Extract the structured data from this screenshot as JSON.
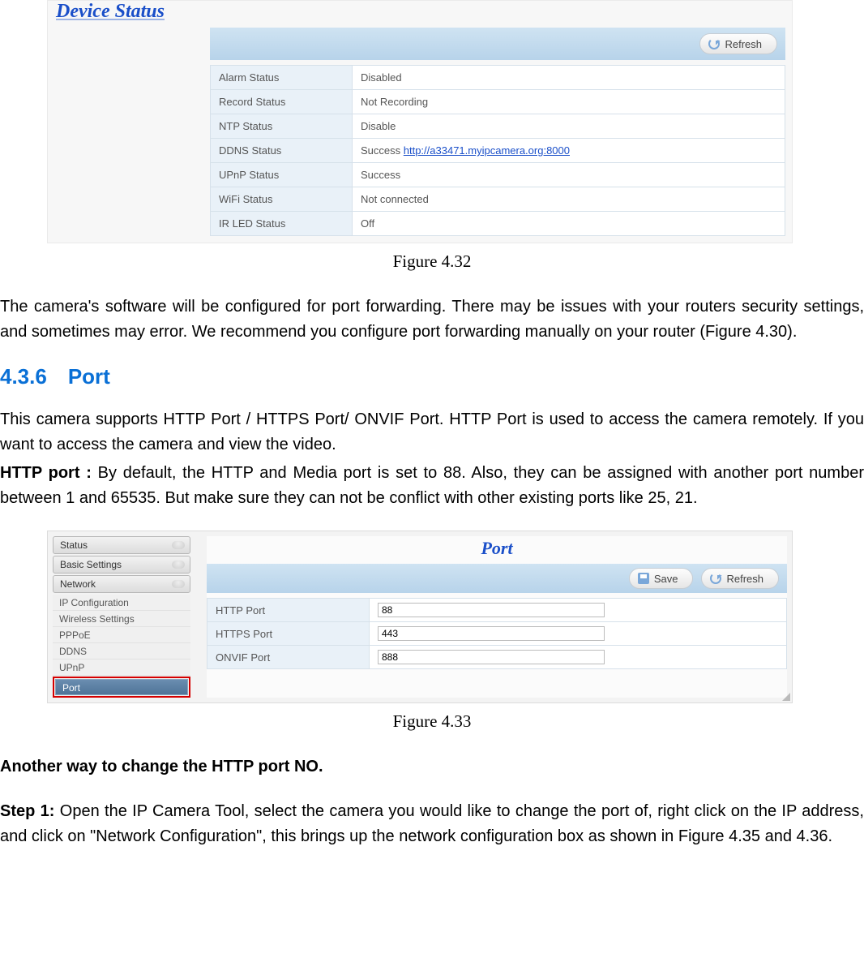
{
  "fig432": {
    "title": "Device Status",
    "refresh": "Refresh",
    "rows": [
      {
        "label": "Alarm Status",
        "value": "Disabled"
      },
      {
        "label": "Record Status",
        "value": "Not Recording"
      },
      {
        "label": "NTP Status",
        "value": "Disable"
      },
      {
        "label": "DDNS Status",
        "value_prefix": "Success ",
        "link": "http://a33471.myipcamera.org:8000"
      },
      {
        "label": "UPnP Status",
        "value": "Success"
      },
      {
        "label": "WiFi Status",
        "value": "Not connected"
      },
      {
        "label": "IR LED Status",
        "value": "Off"
      }
    ],
    "caption": "Figure 4.32"
  },
  "para1": "The camera's software will be configured for port forwarding. There may be issues with your routers security settings, and sometimes may error. We recommend you configure port forwarding manually on your router (Figure 4.30).",
  "section_heading": "4.3.6 Port",
  "para2": "This camera supports HTTP Port / HTTPS Port/ ONVIF Port. HTTP Port is used to access the camera remotely. If you want to access the camera and view the video.",
  "para3_bold": "HTTP port : ",
  "para3_rest": "By default, the HTTP and Media port is set to 88. Also, they can be assigned with another port number between 1 and 65535. But make sure they can not be conflict with other existing ports like 25, 21.",
  "fig433": {
    "sidebar_groups": [
      "Status",
      "Basic Settings",
      "Network"
    ],
    "sidebar_items": [
      "IP Configuration",
      "Wireless Settings",
      "PPPoE",
      "DDNS",
      "UPnP"
    ],
    "sidebar_active": "Port",
    "title": "Port",
    "save": "Save",
    "refresh": "Refresh",
    "rows": [
      {
        "label": "HTTP Port",
        "value": "88"
      },
      {
        "label": "HTTPS Port",
        "value": "443"
      },
      {
        "label": "ONVIF Port",
        "value": "888"
      }
    ],
    "caption": "Figure 4.33"
  },
  "para4": "Another way to change the HTTP port NO.",
  "para5_bold": "Step 1: ",
  "para5_rest": "Open the IP Camera Tool, select the camera you would like to change the port of, right click on the IP address, and click on \"Network Configuration\", this brings up the network configuration box as shown in Figure 4.35 and 4.36."
}
